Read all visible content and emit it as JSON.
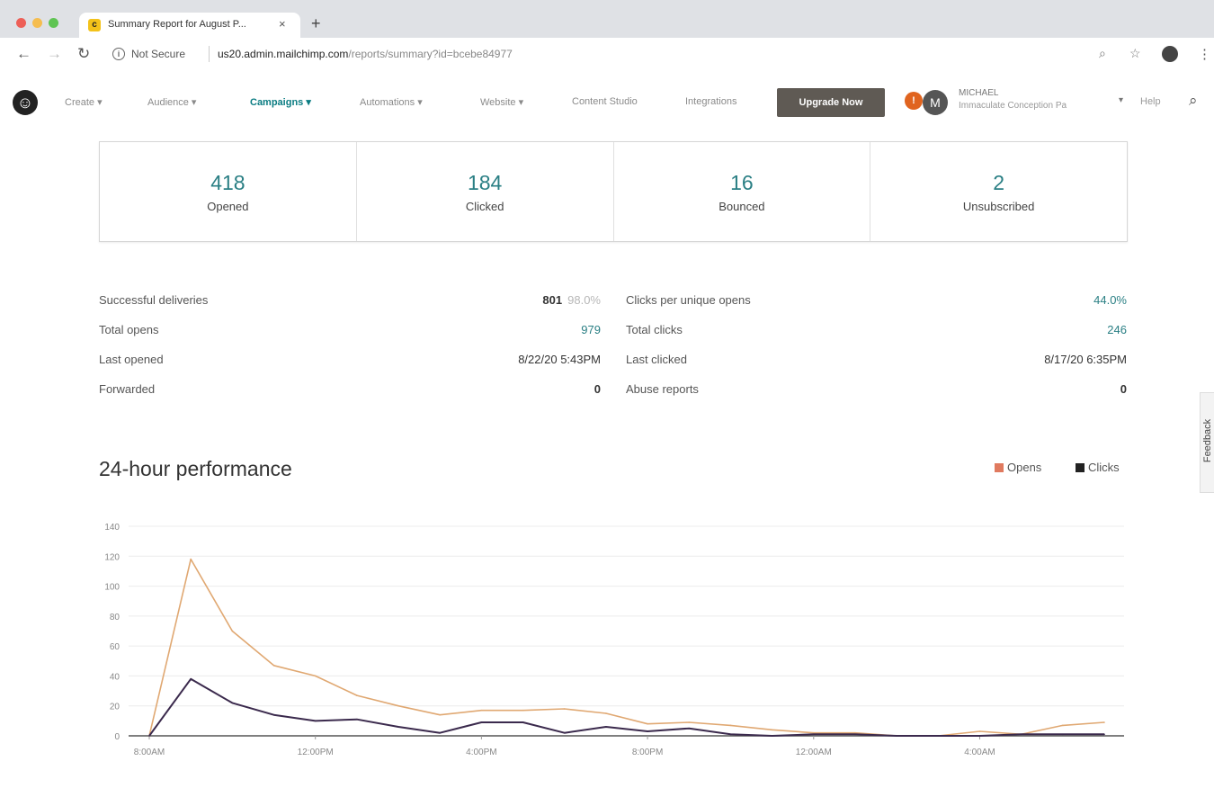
{
  "browser": {
    "tab_title": "Summary Report for August P...",
    "tab_close": "×",
    "new_tab": "+",
    "security_label": "Not Secure",
    "url_host": "us20.admin.mailchimp.com",
    "url_path": "/reports/summary?id=bcebe84977"
  },
  "appnav": {
    "items": [
      "Create ▾",
      "Audience ▾",
      "Campaigns ▾",
      "Automations ▾",
      "Website ▾",
      "Content Studio",
      "Integrations"
    ],
    "active": "Campaigns ▾",
    "upgrade_label": "Upgrade Now",
    "notification": "!",
    "avatar_initial": "M",
    "account_name": "MICHAEL",
    "account_org": "Immaculate Conception Pa",
    "help": "Help"
  },
  "stats": [
    {
      "value": "418",
      "label": "Opened"
    },
    {
      "value": "184",
      "label": "Clicked"
    },
    {
      "value": "16",
      "label": "Bounced"
    },
    {
      "value": "2",
      "label": "Unsubscribed"
    }
  ],
  "metrics_left": [
    {
      "label": "Successful deliveries",
      "value": "801",
      "pct": "98.0%"
    },
    {
      "label": "Total opens",
      "value": "979"
    },
    {
      "label": "Last opened",
      "value": "8/22/20 5:43PM"
    },
    {
      "label": "Forwarded",
      "value": "0"
    }
  ],
  "metrics_right": [
    {
      "label": "Clicks per unique opens",
      "value": "44.0%"
    },
    {
      "label": "Total clicks",
      "value": "246"
    },
    {
      "label": "Last clicked",
      "value": "8/17/20 6:35PM"
    },
    {
      "label": "Abuse reports",
      "value": "0"
    }
  ],
  "section": {
    "title": "24-hour performance",
    "feedback": "Feedback"
  },
  "colors": {
    "opens": "#e07a5f",
    "clicks": "#222222",
    "opens_line": "#e0a872",
    "clicks_line": "#3b2a4d",
    "teal": "#2a7f84"
  },
  "chart_data": {
    "type": "line",
    "x": [
      "8:00AM",
      "9:00AM",
      "10:00AM",
      "11:00AM",
      "12:00PM",
      "1:00PM",
      "2:00PM",
      "3:00PM",
      "4:00PM",
      "5:00PM",
      "6:00PM",
      "7:00PM",
      "8:00PM",
      "9:00PM",
      "10:00PM",
      "11:00PM",
      "12:00AM",
      "1:00AM",
      "2:00AM",
      "3:00AM",
      "4:00AM",
      "5:00AM",
      "6:00AM",
      "7:00AM"
    ],
    "x_tick_labels": [
      "8:00AM",
      "12:00PM",
      "4:00PM",
      "8:00PM",
      "12:00AM",
      "4:00AM"
    ],
    "series": [
      {
        "name": "Opens",
        "values": [
          0,
          118,
          70,
          47,
          40,
          27,
          20,
          14,
          17,
          17,
          18,
          15,
          8,
          9,
          7,
          4,
          2,
          2,
          0,
          0,
          3,
          1,
          7,
          9
        ]
      },
      {
        "name": "Clicks",
        "values": [
          0,
          38,
          22,
          14,
          10,
          11,
          6,
          2,
          9,
          9,
          2,
          6,
          3,
          5,
          1,
          0,
          1,
          1,
          0,
          0,
          0,
          1,
          1,
          1
        ]
      }
    ],
    "yticks": [
      0,
      20,
      40,
      60,
      80,
      100,
      120,
      140
    ],
    "ylim": [
      0,
      140
    ],
    "grid": true,
    "legend": "top-right"
  }
}
